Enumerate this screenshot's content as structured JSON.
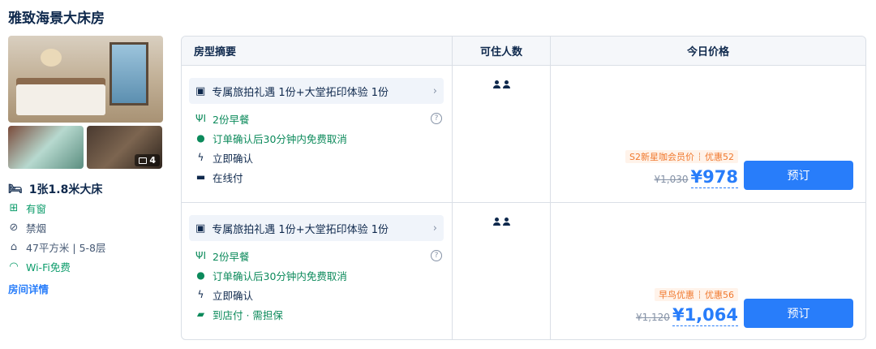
{
  "room": {
    "title": "雅致海景大床房",
    "photo_count": "4",
    "bed": "1张1.8米大床",
    "features": [
      {
        "icon": "window-icon",
        "text": "有窗",
        "accent": "#0c9c6b"
      },
      {
        "icon": "no-smoking-icon",
        "text": "禁烟"
      },
      {
        "icon": "floor-area-icon",
        "text": "47平方米 | 5-8层"
      },
      {
        "icon": "wifi-icon",
        "text": "Wi-Fi免费",
        "accent": "#0c9c6b"
      }
    ],
    "detail_link": "房间详情"
  },
  "table": {
    "headers": [
      "房型摘要",
      "可住人数",
      "今日价格"
    ],
    "rows": [
      {
        "gift": "专属旅拍礼遇 1份+大堂拓印体验 1份",
        "perks": [
          "2份早餐",
          "订单确认后30分钟内免费取消",
          "立即确认",
          "在线付"
        ],
        "guests": 2,
        "promo_name": "S2新星咖会员价",
        "promo_discount": "优惠52",
        "old_price": "¥1,030",
        "new_price": "¥978",
        "book_label": "预订"
      },
      {
        "gift": "专属旅拍礼遇 1份+大堂拓印体验 1份",
        "perks": [
          "2份早餐",
          "订单确认后30分钟内免费取消",
          "立即确认",
          "到店付 · 需担保"
        ],
        "guests": 2,
        "promo_name": "早鸟优惠",
        "promo_discount": "优惠56",
        "old_price": "¥1,120",
        "new_price": "¥1,064",
        "book_label": "预订"
      }
    ]
  },
  "colors": {
    "accent": "#287dfa",
    "promo": "#f0782d",
    "green": "#0c8a5b",
    "text": "#0f294d"
  }
}
